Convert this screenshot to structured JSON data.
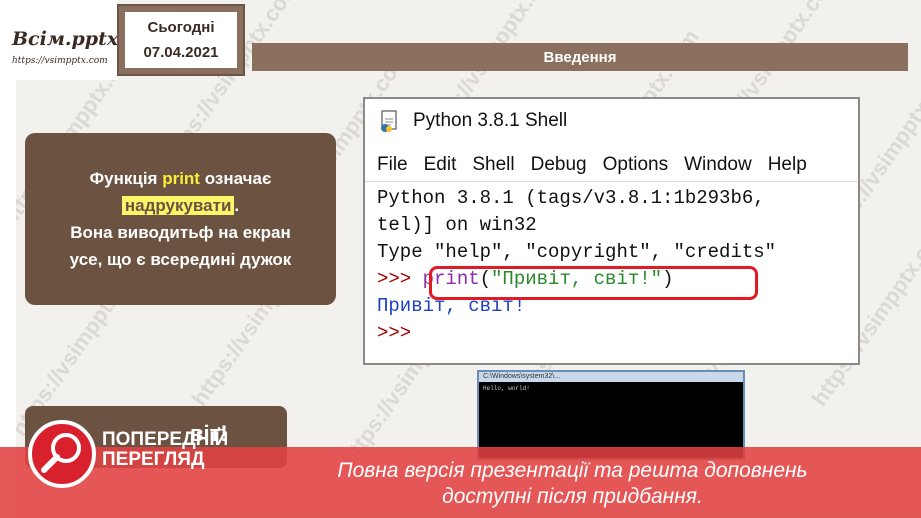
{
  "logo": {
    "main": "Всім.pptx",
    "sub": "https://vsimpptx.com"
  },
  "date": {
    "label": "Сьогодні",
    "value": "07.04.2021"
  },
  "slide_title": "Введення",
  "info": {
    "line1_pre": "Функція ",
    "line1_kw": "print",
    "line1_post": " означає",
    "line2": "надрукувати",
    "line2_post": ".",
    "line3": "Вона виводитьф на екран",
    "line4": "усе, що є всередині дужок"
  },
  "shell": {
    "title": "Python 3.8.1 Shell",
    "menu": [
      "File",
      "Edit",
      "Shell",
      "Debug",
      "Options",
      "Window",
      "Help"
    ],
    "lines": {
      "l1": "Python 3.8.1 (tags/v3.8.1:1b293b6,",
      "l2": "tel)] on win32",
      "l3": "Type \"help\", \"copyright\", \"credits\"",
      "prompt": ">>> ",
      "print_kw": "print",
      "print_args": "(\"Привіт, світ!\")",
      "paren_open": "(",
      "paren_close": ")",
      "string": "\"Привіт, світ!\"",
      "output": "Привіт, світ!",
      "prompt2": ">>>"
    }
  },
  "console": {
    "title": "C:\\Windows\\system32\\...",
    "text": "Hello, world!"
  },
  "bottom_card_text": "віт!",
  "banner": {
    "title_line1": "ПОПЕРЕДНІЙ",
    "title_line2": "ПЕРЕГЛЯД",
    "message_line1": "Повна версія презентації та решта доповнень",
    "message_line2": "доступні після придбання."
  },
  "colors": {
    "brown": "#6b5241",
    "title_bar": "#8b6f5f",
    "banner_red": "#e14141",
    "highlight": "#fcf56a"
  },
  "watermark_text": "https://vsimpptx.com"
}
